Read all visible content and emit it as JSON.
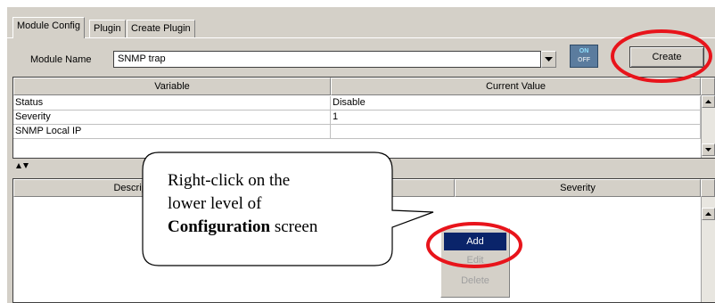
{
  "tabs": [
    {
      "label": "Module Config",
      "active": true
    },
    {
      "label": "Plugin",
      "active": false
    },
    {
      "label": "Create Plugin",
      "active": false
    }
  ],
  "module": {
    "label": "Module Name",
    "value": "SNMP trap",
    "toggle_on": "ON",
    "toggle_off": "OFF",
    "create_label": "Create"
  },
  "variables_table": {
    "headers": [
      "Variable",
      "Current Value"
    ],
    "rows": [
      {
        "variable": "Status",
        "value": "Disable"
      },
      {
        "variable": "Severity",
        "value": "1"
      },
      {
        "variable": "SNMP Local IP",
        "value": ""
      }
    ]
  },
  "lower_table": {
    "headers": [
      "Description",
      "",
      "Severity"
    ]
  },
  "context_menu": {
    "items": [
      {
        "label": "Add",
        "state": "selected"
      },
      {
        "label": "Edit",
        "state": "disabled"
      },
      {
        "label": "Delete",
        "state": "disabled"
      }
    ]
  },
  "callout": {
    "line1": "Right-click on the",
    "line2": "lower level of",
    "bold": "Configuration",
    "suffix": " screen"
  },
  "colors": {
    "panel": "#d4d0c8",
    "highlight_circle": "#e8141b",
    "menu_selection": "#0a246a"
  },
  "icons": {
    "combo": "triangle-down",
    "splitter": "up-down-arrows",
    "scroll_up": "triangle-up",
    "scroll_down": "triangle-down"
  }
}
